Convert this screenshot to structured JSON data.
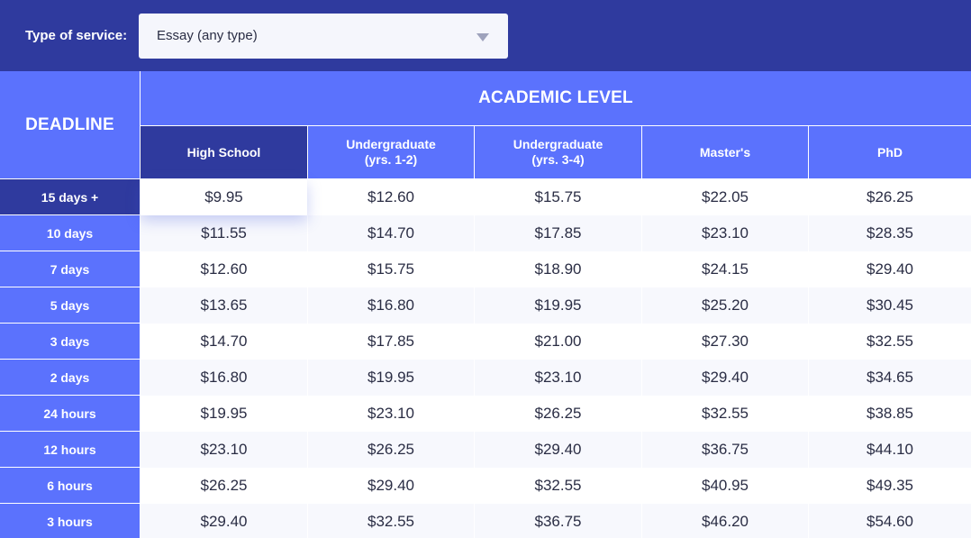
{
  "service": {
    "label": "Type of service:",
    "selected": "Essay (any type)"
  },
  "table": {
    "deadline_header": "DEADLINE",
    "academic_header": "ACADEMIC LEVEL",
    "levels": [
      "High School",
      "Undergraduate\n(yrs. 1-2)",
      "Undergraduate\n(yrs. 3-4)",
      "Master's",
      "PhD"
    ],
    "selected_level": "High School",
    "selected_deadline": "15 days +",
    "rows": [
      {
        "deadline": "15 days +",
        "prices": [
          "$9.95",
          "$12.60",
          "$15.75",
          "$22.05",
          "$26.25"
        ]
      },
      {
        "deadline": "10 days",
        "prices": [
          "$11.55",
          "$14.70",
          "$17.85",
          "$23.10",
          "$28.35"
        ]
      },
      {
        "deadline": "7 days",
        "prices": [
          "$12.60",
          "$15.75",
          "$18.90",
          "$24.15",
          "$29.40"
        ]
      },
      {
        "deadline": "5 days",
        "prices": [
          "$13.65",
          "$16.80",
          "$19.95",
          "$25.20",
          "$30.45"
        ]
      },
      {
        "deadline": "3 days",
        "prices": [
          "$14.70",
          "$17.85",
          "$21.00",
          "$27.30",
          "$32.55"
        ]
      },
      {
        "deadline": "2 days",
        "prices": [
          "$16.80",
          "$19.95",
          "$23.10",
          "$29.40",
          "$34.65"
        ]
      },
      {
        "deadline": "24 hours",
        "prices": [
          "$19.95",
          "$23.10",
          "$26.25",
          "$32.55",
          "$38.85"
        ]
      },
      {
        "deadline": "12 hours",
        "prices": [
          "$23.10",
          "$26.25",
          "$29.40",
          "$36.75",
          "$44.10"
        ]
      },
      {
        "deadline": "6 hours",
        "prices": [
          "$26.25",
          "$29.40",
          "$32.55",
          "$40.95",
          "$49.35"
        ]
      },
      {
        "deadline": "3 hours",
        "prices": [
          "$29.40",
          "$32.55",
          "$36.75",
          "$46.20",
          "$54.60"
        ]
      }
    ]
  },
  "colors": {
    "dark_blue": "#2f3a9e",
    "accent_blue": "#5b72fd",
    "text_dark": "#2a2d44",
    "row_alt": "#f7f8fd"
  }
}
